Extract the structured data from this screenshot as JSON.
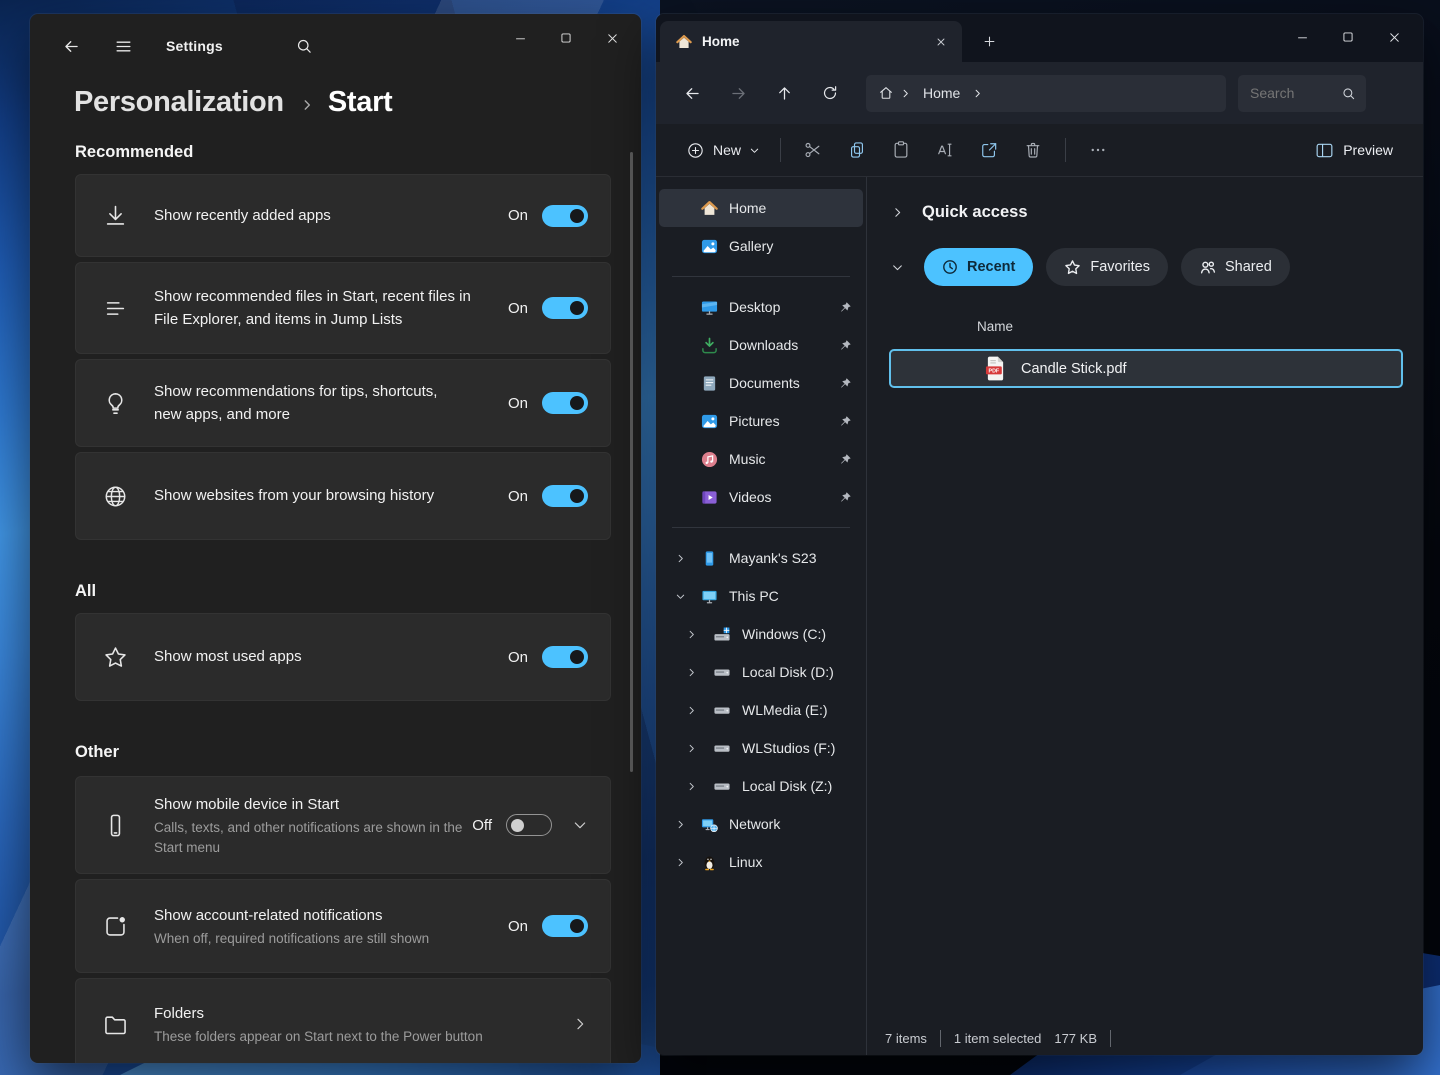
{
  "settings": {
    "titlebar": {
      "app_title": "Settings"
    },
    "breadcrumb": {
      "parent": "Personalization",
      "current": "Start"
    },
    "sections": [
      {
        "heading": "Recommended",
        "rows": [
          {
            "icon": "download-icon",
            "title": "Show recently added apps",
            "toggle": "On"
          },
          {
            "icon": "jump-list-icon",
            "title": "Show recommended files in Start, recent files in File Explorer, and items in Jump Lists",
            "toggle": "On"
          },
          {
            "icon": "lightbulb-icon",
            "title": "Show recommendations for tips, shortcuts, new apps, and more",
            "toggle": "On"
          },
          {
            "icon": "globe-icon",
            "title": "Show websites from your browsing history",
            "toggle": "On"
          }
        ]
      },
      {
        "heading": "All",
        "rows": [
          {
            "icon": "star-icon",
            "title": "Show most used apps",
            "toggle": "On"
          }
        ]
      },
      {
        "heading": "Other",
        "rows": [
          {
            "icon": "mobile-device-icon",
            "title": "Show mobile device in Start",
            "subtitle": "Calls, texts, and other notifications are shown in the Start menu",
            "toggle": "Off"
          },
          {
            "icon": "account-notification-icon",
            "title": "Show account-related notifications",
            "subtitle": "When off, required notifications are still shown",
            "toggle": "On"
          },
          {
            "icon": "folder-icon",
            "title": "Folders",
            "subtitle": "These folders appear on Start next to the Power button"
          }
        ]
      }
    ]
  },
  "explorer": {
    "tab": {
      "title": "Home"
    },
    "nav": {
      "breadcrumb": "Home",
      "search_placeholder": "Search"
    },
    "toolbar": {
      "new": "New",
      "preview": "Preview"
    },
    "sidebar": {
      "top": [
        {
          "label": "Home"
        },
        {
          "label": "Gallery"
        }
      ],
      "pinned": [
        {
          "label": "Desktop"
        },
        {
          "label": "Downloads"
        },
        {
          "label": "Documents"
        },
        {
          "label": "Pictures"
        },
        {
          "label": "Music"
        },
        {
          "label": "Videos"
        }
      ],
      "devices": [
        {
          "label": "Mayank's S23"
        },
        {
          "label": "This PC"
        }
      ],
      "drives": [
        {
          "label": "Windows (C:)"
        },
        {
          "label": "Local Disk (D:)"
        },
        {
          "label": "WLMedia (E:)"
        },
        {
          "label": "WLStudios (F:)"
        },
        {
          "label": "Local Disk (Z:)"
        }
      ],
      "network": [
        {
          "label": "Network"
        },
        {
          "label": "Linux"
        }
      ]
    },
    "content": {
      "section_title": "Quick access",
      "filters": [
        {
          "label": "Recent",
          "active": true
        },
        {
          "label": "Favorites"
        },
        {
          "label": "Shared"
        }
      ],
      "column_name": "Name",
      "file": {
        "name": "Candle Stick.pdf",
        "type": "PDF"
      }
    },
    "statusbar": {
      "count": "7 items",
      "selected": "1 item selected",
      "size": "177 KB"
    }
  },
  "colors": {
    "accent": "#4cc2ff",
    "selection_border": "#61c0ec",
    "toggle_on": "#4cc2ff"
  }
}
